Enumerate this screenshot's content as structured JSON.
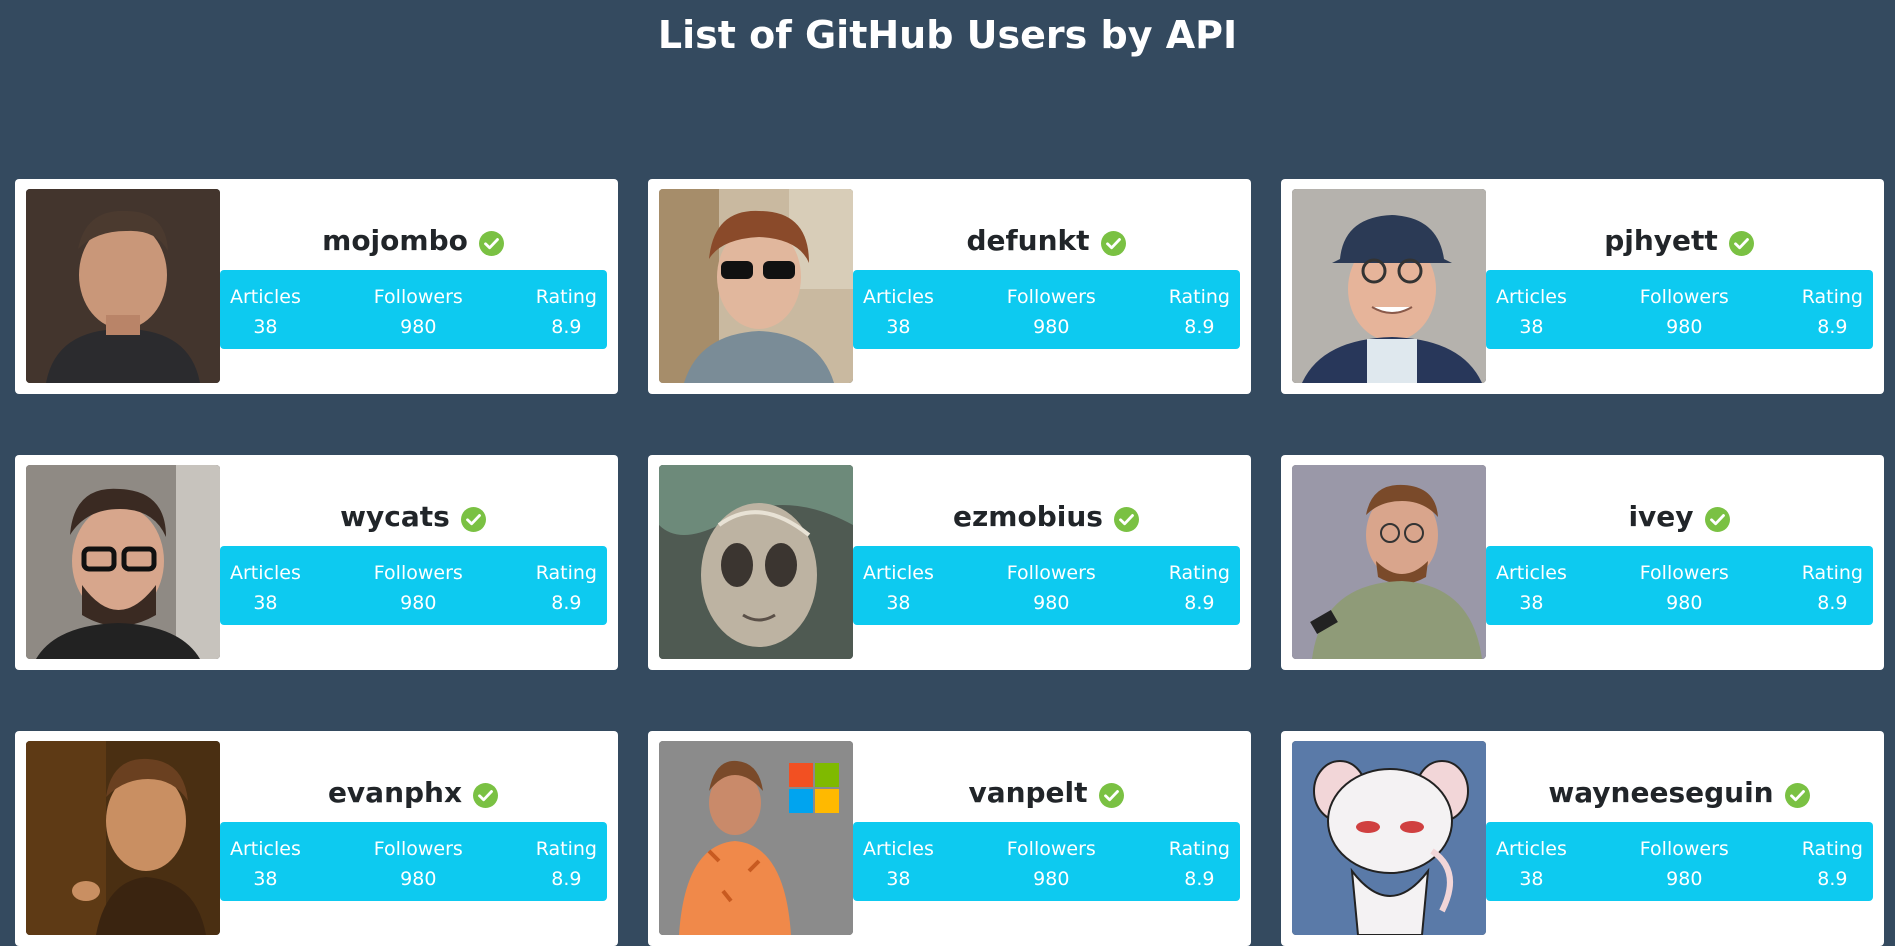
{
  "page": {
    "title": "List of GitHub Users by API"
  },
  "colors": {
    "background": "#344a5f",
    "card": "#ffffff",
    "stats_bar": "#0dcaf0",
    "verified_badge": "#7ac143"
  },
  "stat_labels": {
    "articles": "Articles",
    "followers": "Followers",
    "rating": "Rating"
  },
  "users": [
    {
      "login": "mojombo",
      "avatar_icon": "avatar-photo",
      "verified_icon": "verified-badge-icon",
      "articles": "38",
      "followers": "980",
      "rating": "8.9"
    },
    {
      "login": "defunkt",
      "avatar_icon": "avatar-photo",
      "verified_icon": "verified-badge-icon",
      "articles": "38",
      "followers": "980",
      "rating": "8.9"
    },
    {
      "login": "pjhyett",
      "avatar_icon": "avatar-photo",
      "verified_icon": "verified-badge-icon",
      "articles": "38",
      "followers": "980",
      "rating": "8.9"
    },
    {
      "login": "wycats",
      "avatar_icon": "avatar-photo",
      "verified_icon": "verified-badge-icon",
      "articles": "38",
      "followers": "980",
      "rating": "8.9"
    },
    {
      "login": "ezmobius",
      "avatar_icon": "avatar-photo",
      "verified_icon": "verified-badge-icon",
      "articles": "38",
      "followers": "980",
      "rating": "8.9"
    },
    {
      "login": "ivey",
      "avatar_icon": "avatar-photo",
      "verified_icon": "verified-badge-icon",
      "articles": "38",
      "followers": "980",
      "rating": "8.9"
    },
    {
      "login": "evanphx",
      "avatar_icon": "avatar-photo",
      "verified_icon": "verified-badge-icon",
      "articles": "38",
      "followers": "980",
      "rating": "8.9"
    },
    {
      "login": "vanpelt",
      "avatar_icon": "avatar-photo",
      "verified_icon": "verified-badge-icon",
      "articles": "38",
      "followers": "980",
      "rating": "8.9"
    },
    {
      "login": "wayneeseguin",
      "avatar_icon": "avatar-photo",
      "verified_icon": "verified-badge-icon",
      "articles": "38",
      "followers": "980",
      "rating": "8.9"
    }
  ]
}
